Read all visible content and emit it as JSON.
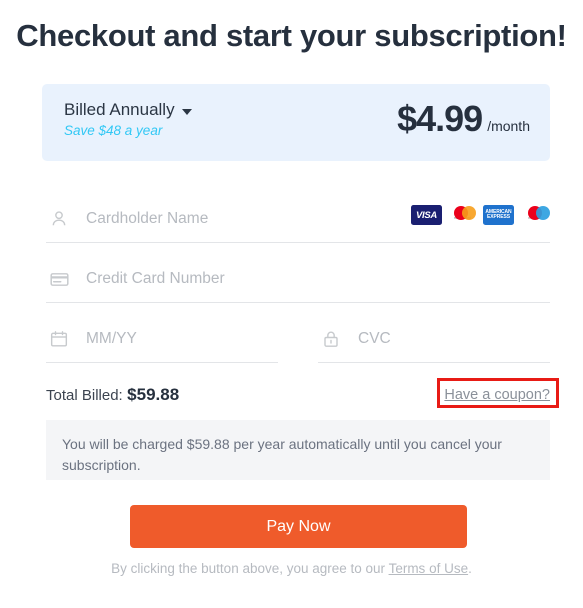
{
  "page": {
    "title": "Checkout and start your subscription!"
  },
  "plan": {
    "cycle_label": "Billed Annually",
    "cycle_caret_icon": "chevron-down-icon",
    "savings_label": "Save $48 a year",
    "price_amount": "$4.99",
    "price_period": "/month",
    "banner_bg": "#e9f2fd",
    "savings_color": "#32c8f5"
  },
  "form": {
    "cardholder": {
      "icon": "person-icon",
      "placeholder": "Cardholder Name",
      "value": ""
    },
    "card_number": {
      "icon": "credit-card-icon",
      "placeholder": "Credit Card Number",
      "value": ""
    },
    "expiry": {
      "icon": "calendar-icon",
      "placeholder": "MM/YY",
      "value": ""
    },
    "cvc": {
      "icon": "lock-icon",
      "placeholder": "CVC",
      "value": ""
    },
    "card_brands": [
      {
        "name": "visa",
        "label": "VISA"
      },
      {
        "name": "mastercard",
        "label": "mastercard"
      },
      {
        "name": "american-express",
        "label": "AMERICAN EXPRESS"
      },
      {
        "name": "maestro",
        "label": "maestro"
      }
    ]
  },
  "total": {
    "label": "Total Billed:",
    "amount": "$59.88",
    "coupon_link": "Have a coupon?"
  },
  "disclaimer": {
    "text": "You will be charged $59.88 per year automatically until you cancel your subscription."
  },
  "actions": {
    "pay_label": "Pay Now",
    "pay_color": "#ef5b2b"
  },
  "footer": {
    "note_prefix": "By clicking the button above, you agree to our ",
    "terms_label": "Terms of Use",
    "note_suffix": "."
  },
  "annotation": {
    "target": "coupon-link",
    "color": "#e81b15"
  }
}
